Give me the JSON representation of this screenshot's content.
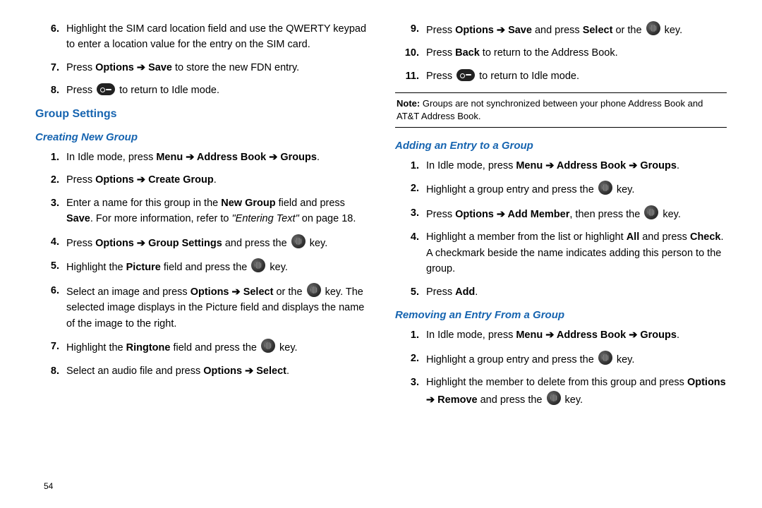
{
  "page_number": "54",
  "left": {
    "list1": [
      {
        "n": "6.",
        "text": "Highlight the SIM card location field and use the QWERTY keypad to enter a location value for the entry on the SIM card."
      },
      {
        "n": "7.",
        "prefix": "Press ",
        "bold1": "Options",
        "arrow": " ➔ ",
        "bold2": "Save",
        "suffix": " to store the new FDN entry."
      },
      {
        "n": "8.",
        "prefix": "Press ",
        "icon": "phone",
        "suffix": " to return to Idle mode."
      }
    ],
    "section": "Group Settings",
    "sub1": "Creating New Group",
    "list2": [
      {
        "n": "1.",
        "prefix": "In Idle mode, press ",
        "bold": "Menu ➔ Address Book ➔ Groups",
        "suffix": "."
      },
      {
        "n": "2.",
        "prefix": "Press ",
        "bold": "Options ➔ Create Group",
        "suffix": "."
      },
      {
        "n": "3.",
        "t1": "Enter a name for this group in the ",
        "b1": "New Group",
        "t2": " field and press ",
        "b2": "Save",
        "t3": ". For more information, refer to ",
        "it": "\"Entering Text\"",
        "t4": " on page 18."
      },
      {
        "n": "4.",
        "prefix": "Press ",
        "bold": "Options ➔ Group Settings",
        "mid": " and press the ",
        "icon": "ok",
        "suffix": " key."
      },
      {
        "n": "5.",
        "prefix": "Highlight the ",
        "bold": "Picture",
        "mid": " field and press the ",
        "icon": "ok",
        "suffix": " key."
      },
      {
        "n": "6.",
        "t1": "Select an image and press ",
        "b1": "Options ➔ Select",
        "t2": " or the ",
        "icon": "ok",
        "t3": " key. The selected image displays in the Picture field and displays the name of the image to the right."
      },
      {
        "n": "7.",
        "prefix": "Highlight the ",
        "bold": "Ringtone",
        "mid": " field and press the ",
        "icon": "ok",
        "suffix": " key."
      },
      {
        "n": "8.",
        "prefix": "Select an audio file and press ",
        "bold": "Options ➔ Select",
        "suffix": "."
      }
    ]
  },
  "right": {
    "list1": [
      {
        "n": "9.",
        "t1": "Press ",
        "b1": "Options ➔ Save",
        "t2": " and press ",
        "b2": "Select",
        "t3": " or the ",
        "icon": "ok",
        "t4": " key."
      },
      {
        "n": "10.",
        "t1": "Press ",
        "b1": "Back",
        "t2": " to return to the Address Book."
      },
      {
        "n": "11.",
        "t1": "Press ",
        "icon": "phone",
        "t2": " to return to Idle mode."
      }
    ],
    "note_label": "Note:",
    "note_text": " Groups are not synchronized between your phone Address Book and AT&T Address Book.",
    "sub2": "Adding an Entry to a Group",
    "list2": [
      {
        "n": "1.",
        "prefix": "In Idle mode, press ",
        "bold": "Menu ➔ Address Book ➔ Groups",
        "suffix": "."
      },
      {
        "n": "2.",
        "prefix": "Highlight a group entry and press the ",
        "icon": "ok",
        "suffix": " key."
      },
      {
        "n": "3.",
        "prefix": "Press ",
        "bold": "Options ➔ Add Member",
        "mid": ", then press the ",
        "icon": "ok",
        "suffix": " key."
      },
      {
        "n": "4.",
        "t1": "Highlight a member from the list or highlight ",
        "b1": "All",
        "t2": " and press ",
        "b2": "Check",
        "t3": ". A checkmark beside the name indicates adding this person to the group."
      },
      {
        "n": "5.",
        "prefix": "Press ",
        "bold": "Add",
        "suffix": "."
      }
    ],
    "sub3": "Removing an Entry From a Group",
    "list3": [
      {
        "n": "1.",
        "prefix": "In Idle mode, press ",
        "bold": "Menu ➔ Address Book ➔ Groups",
        "suffix": "."
      },
      {
        "n": "2.",
        "prefix": "Highlight a group entry and press the ",
        "icon": "ok",
        "suffix": " key."
      },
      {
        "n": "3.",
        "t1": "Highlight the member to delete from this group and press ",
        "b1": "Options ➔ Remove",
        "t2": " and press the ",
        "icon": "ok",
        "t3": " key."
      }
    ]
  }
}
